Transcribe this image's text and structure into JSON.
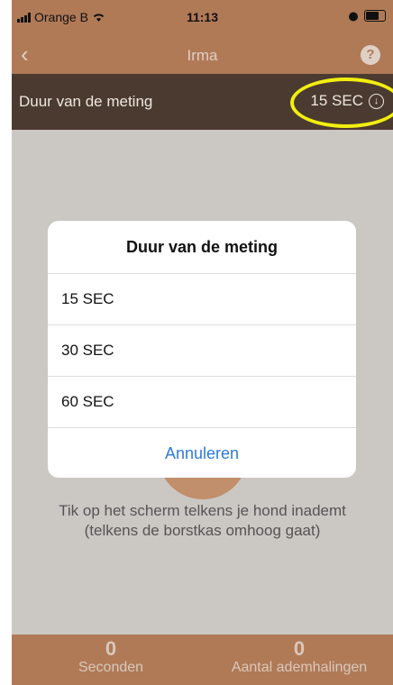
{
  "status_bar": {
    "carrier": "Orange B",
    "time": "11:13"
  },
  "nav": {
    "back": "‹",
    "title": "Irma",
    "help": "?"
  },
  "duration_bar": {
    "label": "Duur van de meting",
    "value": "15 SEC"
  },
  "dialog": {
    "title": "Duur van de meting",
    "options": [
      "15 SEC",
      "30 SEC",
      "60 SEC"
    ],
    "cancel": "Annuleren"
  },
  "instructions": {
    "line1": "Tik op het scherm telkens je hond inademt",
    "line2": "(telkens de borstkas omhoog gaat)"
  },
  "footer": {
    "seconds": {
      "value": "0",
      "label": "Seconden"
    },
    "breaths": {
      "value": "0",
      "label": "Aantal ademhalingen"
    }
  },
  "colors": {
    "accent": "#b07a57",
    "dark_bar": "#4a3a30",
    "highlight": "#f2ee10",
    "link": "#2f7bd8"
  }
}
